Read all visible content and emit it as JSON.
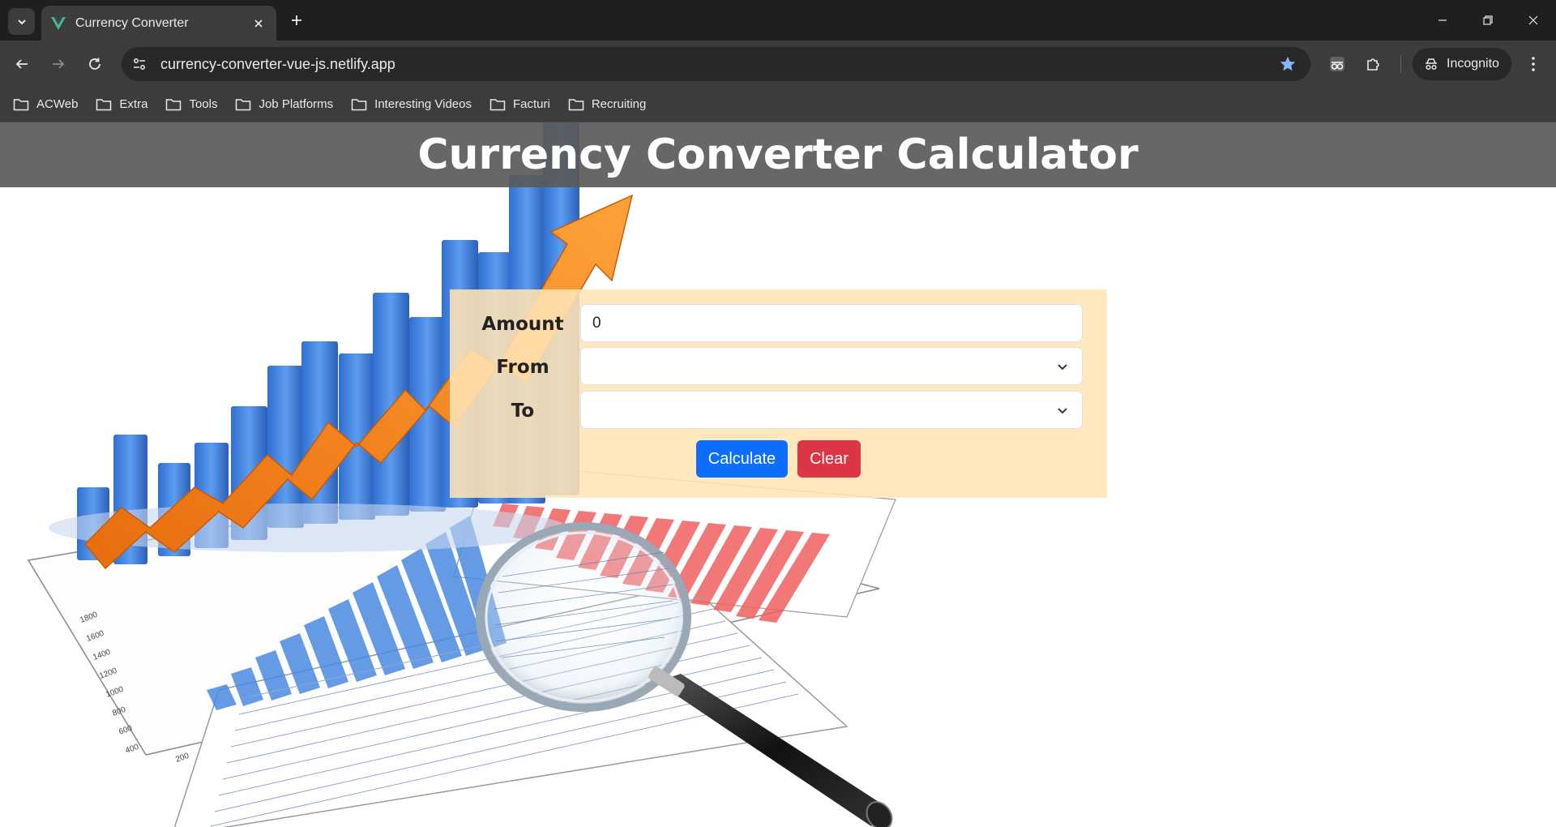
{
  "browser": {
    "tab": {
      "title": "Currency Converter",
      "favicon": "vue-icon"
    },
    "address": {
      "url": "currency-converter-vue-js.netlify.app"
    },
    "profile": {
      "label": "Incognito"
    },
    "bookmarks": [
      {
        "label": "ACWeb"
      },
      {
        "label": "Extra"
      },
      {
        "label": "Tools"
      },
      {
        "label": "Job Platforms"
      },
      {
        "label": "Interesting Videos"
      },
      {
        "label": "Facturi"
      },
      {
        "label": "Recruiting"
      }
    ]
  },
  "page": {
    "title": "Currency Converter Calculator",
    "form": {
      "amount_label": "Amount",
      "amount_value": "0",
      "from_label": "From",
      "from_value": "",
      "to_label": "To",
      "to_value": "",
      "calculate_label": "Calculate",
      "clear_label": "Clear"
    }
  },
  "colors": {
    "header_bg": "#5a5a5a",
    "panel_bg": "#ffe4b5",
    "calculate_bg": "#0d6efd",
    "clear_bg": "#dc3545"
  }
}
